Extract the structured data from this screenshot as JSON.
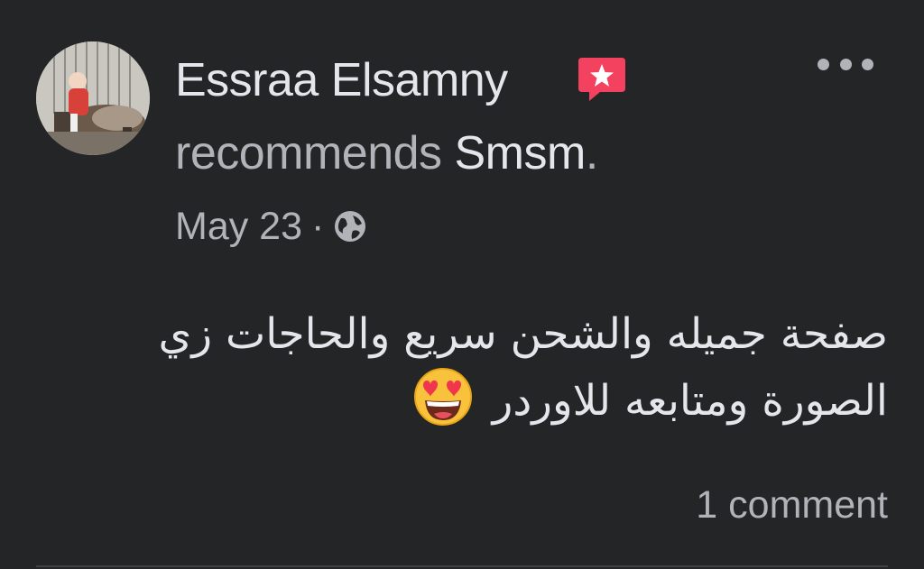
{
  "post": {
    "author": "Essraa Elsamny",
    "recommends_text": "recommends ",
    "page_name": "Smsm",
    "period": ".",
    "date": "May 23",
    "separator": "·",
    "audience_icon": "globe-icon",
    "badge_icon": "recommendation-star-icon",
    "body_line1": "صفحة جميله والشحن سريع والحاجات زي",
    "body_line2": "الصورة ومتابعه للاوردر",
    "emoji": "heart-eyes-emoji",
    "comments": "1 comment"
  },
  "colors": {
    "background": "#242526",
    "primary_text": "#e4e6eb",
    "secondary_text": "#b0b3b8",
    "badge": "#f3425f"
  }
}
